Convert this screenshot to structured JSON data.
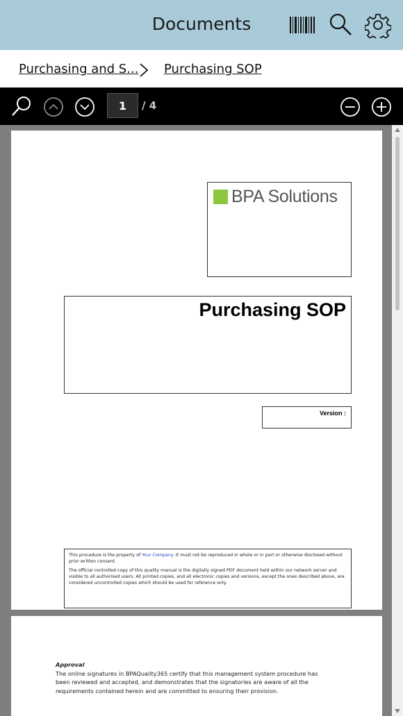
{
  "header": {
    "title": "Documents",
    "icons": [
      "barcode-icon",
      "search-icon",
      "settings-icon"
    ],
    "background": "#a9cad8"
  },
  "breadcrumb": {
    "items": [
      {
        "label": "Purchasing and S..."
      },
      {
        "label": "Purchasing SOP"
      }
    ],
    "separator_icon": "chevron-right-icon"
  },
  "pdf_toolbar": {
    "current_page": "1",
    "total_pages": "/ 4",
    "icons": [
      "search-icon",
      "previous-page-icon",
      "next-page-icon",
      "zoom-out-icon",
      "zoom-in-icon"
    ]
  },
  "document": {
    "page1": {
      "logo_text": "BPA Solutions",
      "logo_color": "#8cc63f",
      "title": "Purchasing SOP",
      "version_label": "Version :",
      "property_notice_prefix": "This procedure is the property of",
      "company_name": "Your Company",
      "property_notice_suffix": ". It must not be reproduced in whole or in part or otherwise disclosed without prior written consent.",
      "controlled_copy_notice": "The official controlled copy of this quality manual is the digitally signed PDF document held within our network server and visible to all authorised users. All printed copies, and all electronic copies and versions, except the ones described above, are considered uncontrolled copies which should be used for reference only."
    },
    "page2": {
      "approval_title": "Approval",
      "approval_text": "The online signatures in BPAQuality365 certify that this management system procedure has been reviewed and accepted, and demonstrates that the signatories are aware of all the requirements contained herein and are committed to ensuring their provision."
    }
  }
}
